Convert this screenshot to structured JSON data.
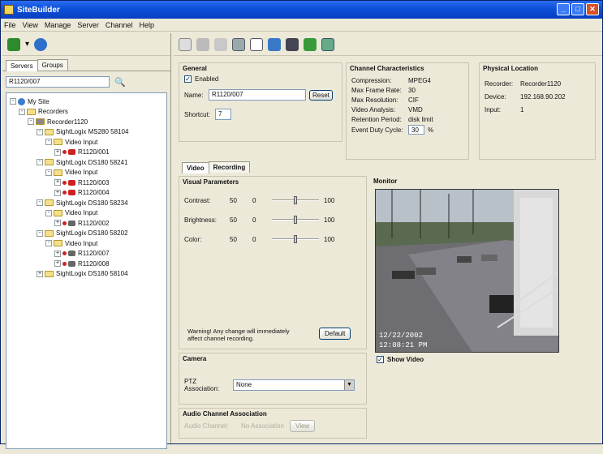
{
  "window": {
    "title": "SiteBuilder"
  },
  "menu": [
    "File",
    "View",
    "Manage",
    "Server",
    "Channel",
    "Help"
  ],
  "left": {
    "tabs": [
      "Servers",
      "Groups"
    ],
    "search_value": "R1120/007",
    "tree": [
      {
        "label": "My Site",
        "indent": 0,
        "exp": "-",
        "icon": "globe"
      },
      {
        "label": "Recorders",
        "indent": 1,
        "exp": "-",
        "icon": "folder"
      },
      {
        "label": "Recorder1120",
        "indent": 2,
        "exp": "-",
        "icon": "recorder"
      },
      {
        "label": "SightLogix MS280 58104",
        "indent": 3,
        "exp": "-",
        "icon": "folder"
      },
      {
        "label": "Video Input",
        "indent": 4,
        "exp": "-",
        "icon": "folder"
      },
      {
        "label": "R1120/001",
        "indent": 5,
        "exp": "+",
        "icon": "camera"
      },
      {
        "label": "SightLogix DS180 58241",
        "indent": 3,
        "exp": "-",
        "icon": "folder"
      },
      {
        "label": "Video Input",
        "indent": 4,
        "exp": "-",
        "icon": "folder"
      },
      {
        "label": "R1120/003",
        "indent": 5,
        "exp": "+",
        "icon": "camera"
      },
      {
        "label": "R1120/004",
        "indent": 5,
        "exp": "+",
        "icon": "camera"
      },
      {
        "label": "SightLogix DS180 58234",
        "indent": 3,
        "exp": "-",
        "icon": "folder"
      },
      {
        "label": "Video Input",
        "indent": 4,
        "exp": "-",
        "icon": "folder"
      },
      {
        "label": "R1120/002",
        "indent": 5,
        "exp": "+",
        "icon": "camera-gray"
      },
      {
        "label": "SightLogix DS180 58202",
        "indent": 3,
        "exp": "-",
        "icon": "folder"
      },
      {
        "label": "Video Input",
        "indent": 4,
        "exp": "-",
        "icon": "folder"
      },
      {
        "label": "R1120/007",
        "indent": 5,
        "exp": "+",
        "icon": "camera-gray"
      },
      {
        "label": "R1120/008",
        "indent": 5,
        "exp": "+",
        "icon": "camera-gray"
      },
      {
        "label": "SightLogix DS180 58104",
        "indent": 3,
        "exp": "+",
        "icon": "folder"
      }
    ]
  },
  "general": {
    "title": "General",
    "enabled_label": "Enabled",
    "name_label": "Name:",
    "name_value": "R1120/007",
    "reset_label": "Reset",
    "shortcut_label": "Shortcut:",
    "shortcut_value": "7"
  },
  "channel": {
    "title": "Channel Characteristics",
    "rows": [
      {
        "k": "Compression:",
        "v": "MPEG4"
      },
      {
        "k": "Max Frame Rate:",
        "v": "30"
      },
      {
        "k": "Max Resolution:",
        "v": "CIF"
      },
      {
        "k": "Video Analysis:",
        "v": "VMD"
      },
      {
        "k": "Retention Period:",
        "v": "disk limit"
      }
    ],
    "duty_label": "Event Duty Cycle:",
    "duty_value": "30",
    "duty_unit": "%"
  },
  "physical": {
    "title": "Physical Location",
    "rows": [
      {
        "k": "Recorder:",
        "v": "Recorder1120"
      },
      {
        "k": "Device:",
        "v": "192.168.90.202"
      },
      {
        "k": "Input:",
        "v": "1"
      }
    ]
  },
  "videotabs": [
    "Video",
    "Recording"
  ],
  "visual": {
    "title": "Visual Parameters",
    "sliders": [
      {
        "name": "Contrast:",
        "value": "50",
        "min": "0",
        "max": "100",
        "level": 0.5
      },
      {
        "name": "Brightness:",
        "value": "50",
        "min": "0",
        "max": "100",
        "level": 0.5
      },
      {
        "name": "Color:",
        "value": "50",
        "min": "0",
        "max": "100",
        "level": 0.5
      }
    ],
    "warning": "Warning! Any change will immediately affect channel recording.",
    "default_label": "Default"
  },
  "camera": {
    "title": "Camera",
    "ptz_label": "PTZ Association:",
    "ptz_value": "None"
  },
  "audio": {
    "title": "Audio Channel Association",
    "channel_label": "Audio Channel:",
    "assoc_value": "No Association",
    "view_label": "View"
  },
  "monitor": {
    "title": "Monitor",
    "show_video_label": "Show Video",
    "timestamp1": "12/22/2002",
    "timestamp2": "12:08:21 PM"
  }
}
